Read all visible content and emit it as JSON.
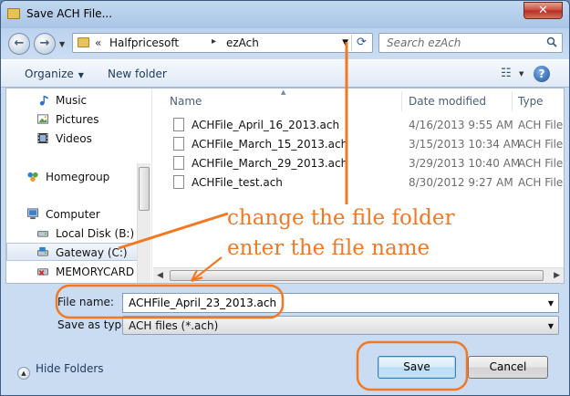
{
  "window": {
    "title": "Save ACH File...",
    "close_label": "✕"
  },
  "address": {
    "crumbs": [
      "Halfpricesoft",
      "ezAch"
    ],
    "overflow": "«",
    "separator": "▸",
    "search_placeholder": "Search ezAch"
  },
  "toolbar": {
    "organize_label": "Organize",
    "new_folder_label": "New folder",
    "help_label": "?"
  },
  "nav": {
    "items": [
      {
        "label": "Music",
        "icon": "music-icon"
      },
      {
        "label": "Pictures",
        "icon": "pictures-icon"
      },
      {
        "label": "Videos",
        "icon": "videos-icon"
      },
      {
        "label": "Homegroup",
        "icon": "homegroup-icon"
      },
      {
        "label": "Computer",
        "icon": "computer-icon"
      },
      {
        "label": "Local Disk (B:)",
        "icon": "disk-icon"
      },
      {
        "label": "Gateway (C:)",
        "icon": "disk-icon",
        "selected": true
      },
      {
        "label": "MEMORYCARD (",
        "icon": "memory-card-icon"
      }
    ]
  },
  "files": {
    "columns": {
      "name": "Name",
      "date": "Date modified",
      "type": "Type"
    },
    "rows": [
      {
        "name": "ACHFile_April_16_2013.ach",
        "date": "4/16/2013 9:55 AM",
        "type": "ACH File"
      },
      {
        "name": "ACHFile_March_15_2013.ach",
        "date": "3/15/2013 10:34 AM",
        "type": "ACH File"
      },
      {
        "name": "ACHFile_March_29_2013.ach",
        "date": "3/29/2013 10:40 AM",
        "type": "ACH File"
      },
      {
        "name": "ACHFile_test.ach",
        "date": "8/30/2012 9:27 AM",
        "type": "ACH File"
      }
    ]
  },
  "form": {
    "filename_label": "File name:",
    "filename_value": "ACHFile_April_23_2013.ach",
    "savetype_label": "Save as type:",
    "savetype_value": "ACH files (*.ach)"
  },
  "footer": {
    "hide_folders_label": "Hide Folders",
    "save_label": "Save",
    "cancel_label": "Cancel"
  },
  "annotations": {
    "line1": "change the file folder",
    "line2": "enter the file name",
    "color": "#f37821"
  }
}
